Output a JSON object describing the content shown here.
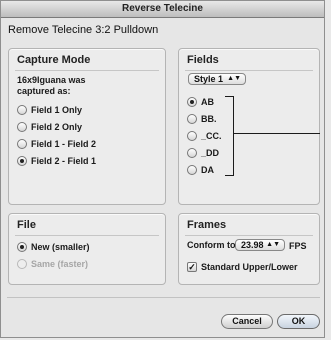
{
  "window": {
    "title": "Reverse Telecine"
  },
  "dialog": {
    "subtitle": "Remove Telecine 3:2 Pulldown"
  },
  "capture_mode": {
    "title": "Capture Mode",
    "description": "16x9Iguana was captured as:",
    "options": [
      "Field 1 Only",
      "Field 2 Only",
      "Field 1 - Field 2",
      "Field 2 - Field 1"
    ],
    "selected": "Field 2 - Field 1"
  },
  "fields": {
    "title": "Fields",
    "style_popup": "Style 1",
    "options": [
      "AB",
      "BB.",
      "_CC.",
      "_DD",
      "DA"
    ],
    "selected": "AB"
  },
  "file": {
    "title": "File",
    "options": [
      "New (smaller)",
      "Same (faster)"
    ],
    "selected": "New (smaller)",
    "disabled": "Same (faster)"
  },
  "frames": {
    "title": "Frames",
    "conform_label": "Conform to:",
    "conform_value": "23.98",
    "fps_label": "FPS",
    "standard_checkbox": "Standard Upper/Lower",
    "standard_checked": true
  },
  "buttons": {
    "cancel": "Cancel",
    "ok": "OK"
  },
  "icons": {
    "popup_arrows": "updown-arrows-icon",
    "check": "checkmark-icon"
  }
}
